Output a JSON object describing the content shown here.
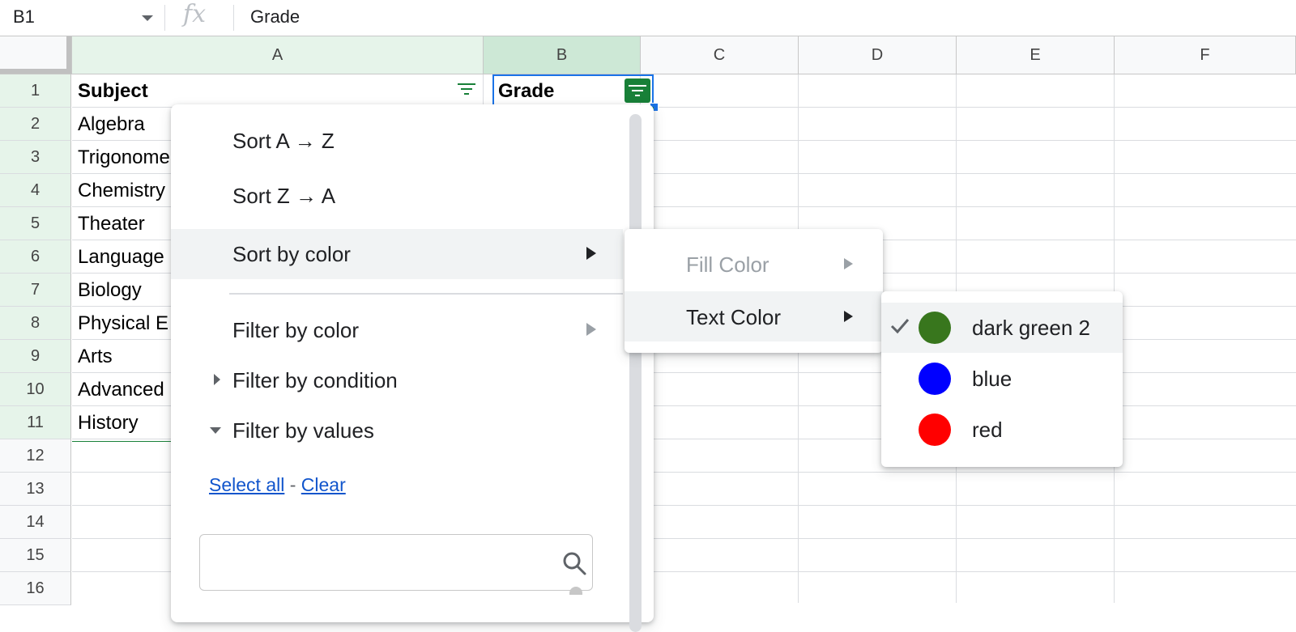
{
  "formula_bar": {
    "cell_ref": "B1",
    "fx_label": "fx",
    "value": "Grade"
  },
  "columns": [
    "A",
    "B",
    "C",
    "D",
    "E",
    "F"
  ],
  "rows": [
    "1",
    "2",
    "3",
    "4",
    "5",
    "6",
    "7",
    "8",
    "9",
    "10",
    "11",
    "12",
    "13",
    "14",
    "15",
    "16"
  ],
  "cells": {
    "a": [
      "Subject",
      "Algebra",
      "Trigonome",
      "Chemistry",
      "Theater",
      "Language",
      "Biology",
      "Physical E",
      "Arts",
      "Advanced",
      "History"
    ],
    "b1": "Grade"
  },
  "filter_menu": {
    "sort_az": "Sort A → Z",
    "sort_za": "Sort Z → A",
    "sort_by_color": "Sort by color",
    "filter_by_color": "Filter by color",
    "filter_by_condition": "Filter by condition",
    "filter_by_values": "Filter by values",
    "select_all": "Select all",
    "separator": "-",
    "clear": "Clear",
    "search_placeholder": ""
  },
  "sort_by_color_submenu": {
    "fill_color": "Fill Color",
    "text_color": "Text Color"
  },
  "text_color_submenu": {
    "items": [
      {
        "label": "dark green 2",
        "color": "#38761d",
        "checked": true
      },
      {
        "label": "blue",
        "color": "#0000ff",
        "checked": false
      },
      {
        "label": "red",
        "color": "#ff0000",
        "checked": false
      }
    ]
  },
  "colors": {
    "selection": "#1a73e8",
    "filter_active": "#188038",
    "link": "#1155cc"
  }
}
